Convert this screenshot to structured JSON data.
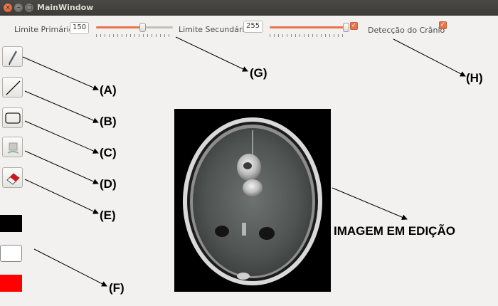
{
  "window": {
    "title": "MainWindow"
  },
  "controls": {
    "primary": {
      "label": "Limite Primário",
      "value": "150",
      "level": 0.6
    },
    "secondary": {
      "label": "Limite Secundário",
      "value": "255",
      "level": 1.0,
      "checked": true
    },
    "skull": {
      "label": "Detecção do Crânio",
      "checked": true
    }
  },
  "tools": [
    {
      "icon": "pencil-icon"
    },
    {
      "icon": "line-icon"
    },
    {
      "icon": "rectangle-icon"
    },
    {
      "icon": "fill-bucket-icon"
    },
    {
      "icon": "eraser-icon"
    }
  ],
  "colors": [
    {
      "name": "black",
      "hex": "#000000"
    },
    {
      "name": "white",
      "hex": "#ffffff"
    },
    {
      "name": "red",
      "hex": "#ff0000"
    }
  ],
  "callouts": {
    "a": "(A)",
    "b": "(B)",
    "c": "(C)",
    "d": "(D)",
    "e": "(E)",
    "f": "(F)",
    "g": "(G)",
    "h": "(H)"
  },
  "canvas": {
    "caption": "IMAGEM EM EDIÇÃO"
  }
}
